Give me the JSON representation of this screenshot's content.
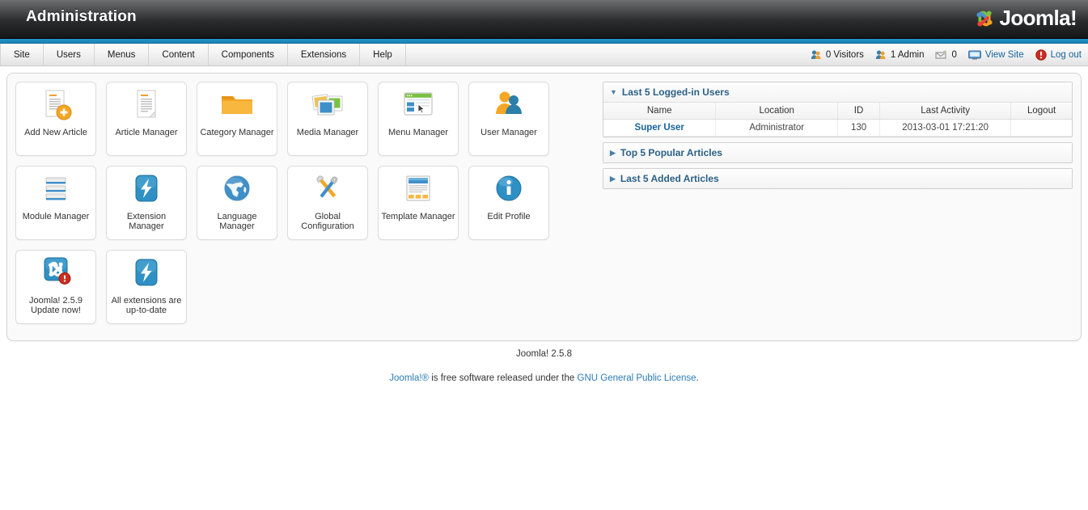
{
  "header": {
    "title": "Administration",
    "logo_text": "Joomla!"
  },
  "menubar": {
    "items": [
      {
        "label": "Site"
      },
      {
        "label": "Users"
      },
      {
        "label": "Menus"
      },
      {
        "label": "Content"
      },
      {
        "label": "Components"
      },
      {
        "label": "Extensions"
      },
      {
        "label": "Help"
      }
    ],
    "status": {
      "visitors": "0 Visitors",
      "admins": "1 Admin",
      "messages": "0",
      "view_site": "View Site",
      "logout": "Log out"
    }
  },
  "quickicons": [
    {
      "label": "Add New Article",
      "icon": "article-add-icon"
    },
    {
      "label": "Article Manager",
      "icon": "article-icon"
    },
    {
      "label": "Category Manager",
      "icon": "folder-icon"
    },
    {
      "label": "Media Manager",
      "icon": "media-icon"
    },
    {
      "label": "Menu Manager",
      "icon": "menu-icon"
    },
    {
      "label": "User Manager",
      "icon": "users-icon"
    },
    {
      "label": "Module Manager",
      "icon": "module-icon"
    },
    {
      "label": "Extension Manager",
      "icon": "bolt-icon"
    },
    {
      "label": "Language Manager",
      "icon": "globe-icon"
    },
    {
      "label": "Global\nConfiguration",
      "icon": "tools-icon"
    },
    {
      "label": "Template Manager",
      "icon": "template-icon"
    },
    {
      "label": "Edit Profile",
      "icon": "info-icon"
    },
    {
      "label": "Joomla! 2.5.9\nUpdate now!",
      "icon": "joomla-update-icon"
    },
    {
      "label": "All extensions are\nup-to-date",
      "icon": "bolt-icon"
    }
  ],
  "modules": {
    "logged_in": {
      "title": "Last 5 Logged-in Users",
      "expanded": true,
      "columns": [
        "Name",
        "Location",
        "ID",
        "Last Activity",
        "Logout"
      ],
      "rows": [
        {
          "name": "Super User",
          "location": "Administrator",
          "id": "130",
          "last_activity": "2013-03-01 17:21:20",
          "logout": ""
        }
      ]
    },
    "popular": {
      "title": "Top 5 Popular Articles",
      "expanded": false
    },
    "added": {
      "title": "Last 5 Added Articles",
      "expanded": false
    }
  },
  "footer": {
    "version": "Joomla! 2.5.8",
    "license_prefix": "Joomla!®",
    "license_middle": " is free software released under the ",
    "license_link": "GNU General Public License",
    "license_suffix": "."
  },
  "colors": {
    "accent_blue": "#2390c4",
    "link_blue": "#17649a",
    "header_dark": "#2a2b2d",
    "module_title": "#2b6186"
  }
}
